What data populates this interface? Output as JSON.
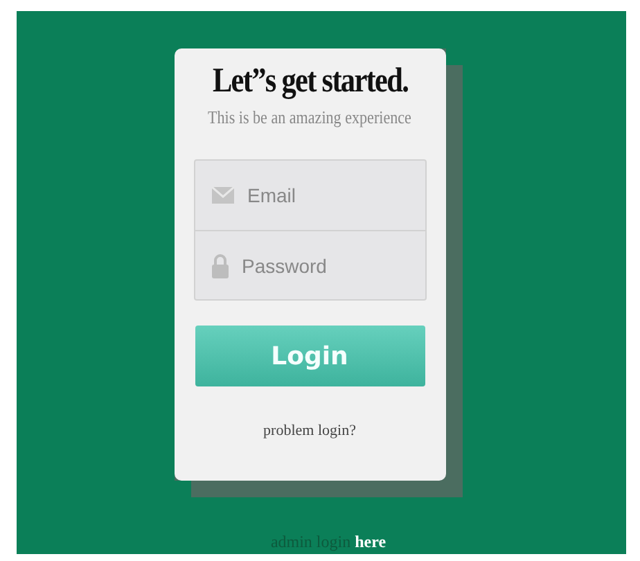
{
  "card": {
    "title": "Let”s get started.",
    "subtitle": "This is be an amazing experience",
    "fields": [
      {
        "kind": "email",
        "placeholder": "Email"
      },
      {
        "kind": "password",
        "placeholder": "Password"
      }
    ],
    "button": "Login",
    "help_link": "problem login?"
  },
  "footer": {
    "text": "admin login",
    "link": "here"
  }
}
